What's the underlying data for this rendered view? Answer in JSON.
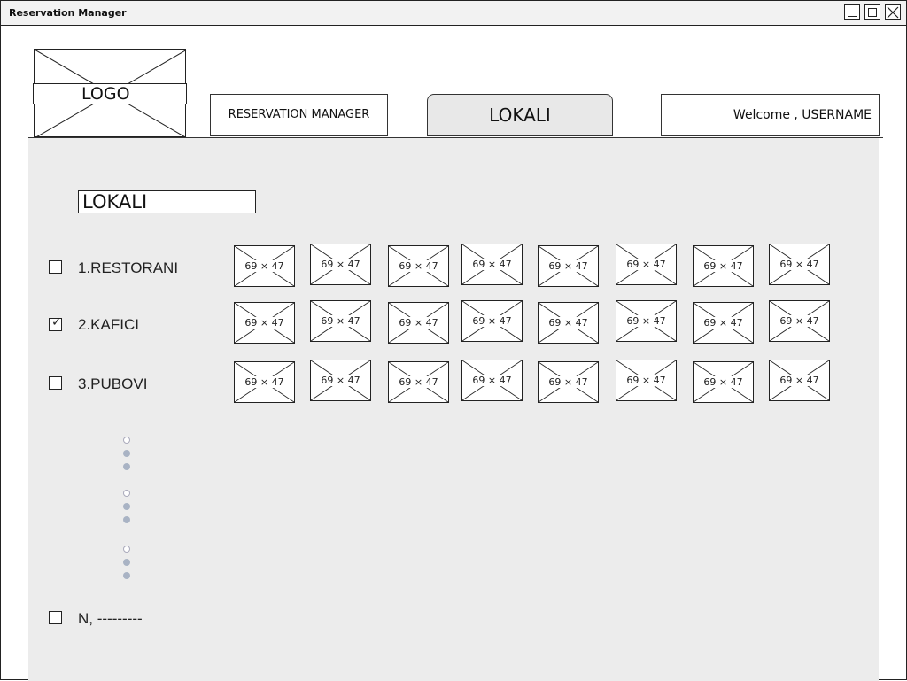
{
  "window": {
    "title": "Reservation Manager"
  },
  "header": {
    "logo_label": "LOGO",
    "app_title": "RESERVATION MANAGER",
    "active_tab": "LOKALI",
    "welcome": "Welcome , USERNAME"
  },
  "main": {
    "section_title": "LOKALI",
    "rows": [
      {
        "label": "1.RESTORANI",
        "checked": false
      },
      {
        "label": "2.KAFICI",
        "checked": true
      },
      {
        "label": "3.PUBOVI",
        "checked": false
      }
    ],
    "thumb_label": "69 × 47",
    "last_row": {
      "label": "N, ---------",
      "checked": false
    }
  },
  "colors": {
    "content_bg": "#ececec",
    "dot_filled": "#a9b3c4"
  }
}
